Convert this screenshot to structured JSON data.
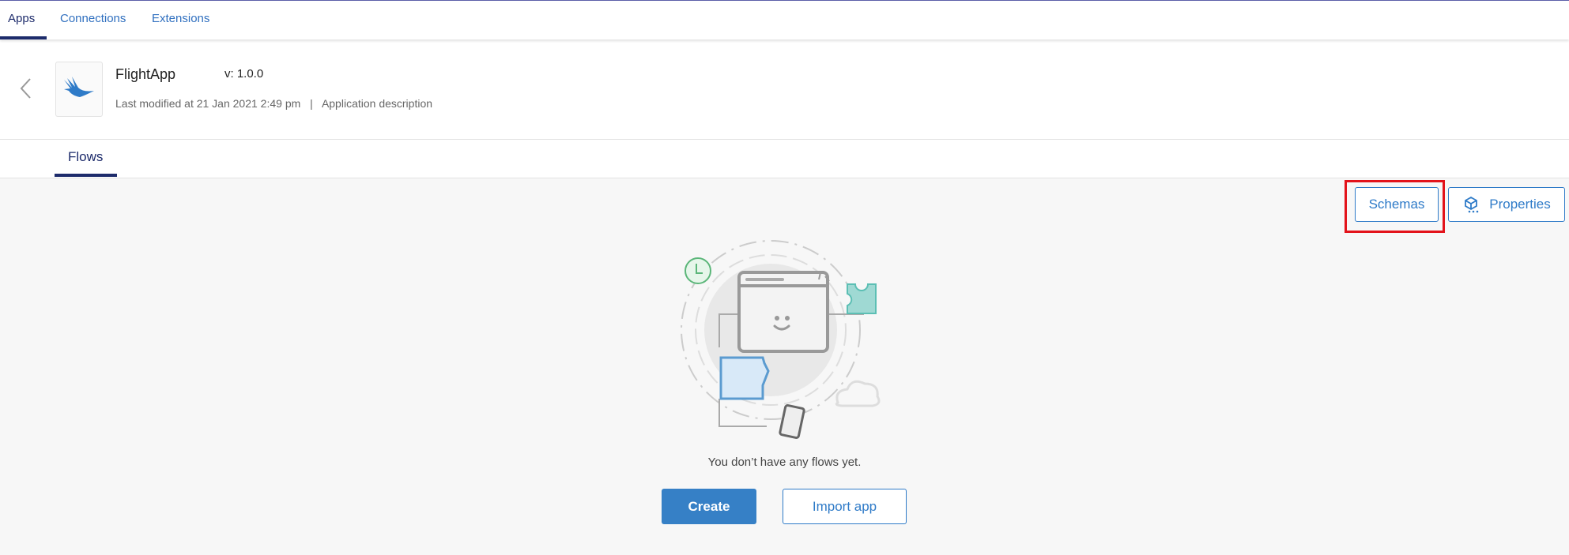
{
  "topnav": {
    "tabs": [
      {
        "label": "Apps",
        "active": true
      },
      {
        "label": "Connections"
      },
      {
        "label": "Extensions"
      }
    ]
  },
  "app": {
    "name": "FlightApp",
    "version": "v: 1.0.0",
    "last_modified": "Last modified at 21 Jan 2021 2:49 pm",
    "separator": "|",
    "description": "Application description"
  },
  "subtabs": {
    "flows": "Flows"
  },
  "actions": {
    "schemas": "Schemas",
    "properties": "Properties"
  },
  "empty_state": {
    "message": "You don’t have any flows yet.",
    "create": "Create",
    "import": "Import app"
  },
  "colors": {
    "accent": "#2f7bc8",
    "nav_active": "#1d2b6b",
    "highlight": "#e3131b"
  }
}
